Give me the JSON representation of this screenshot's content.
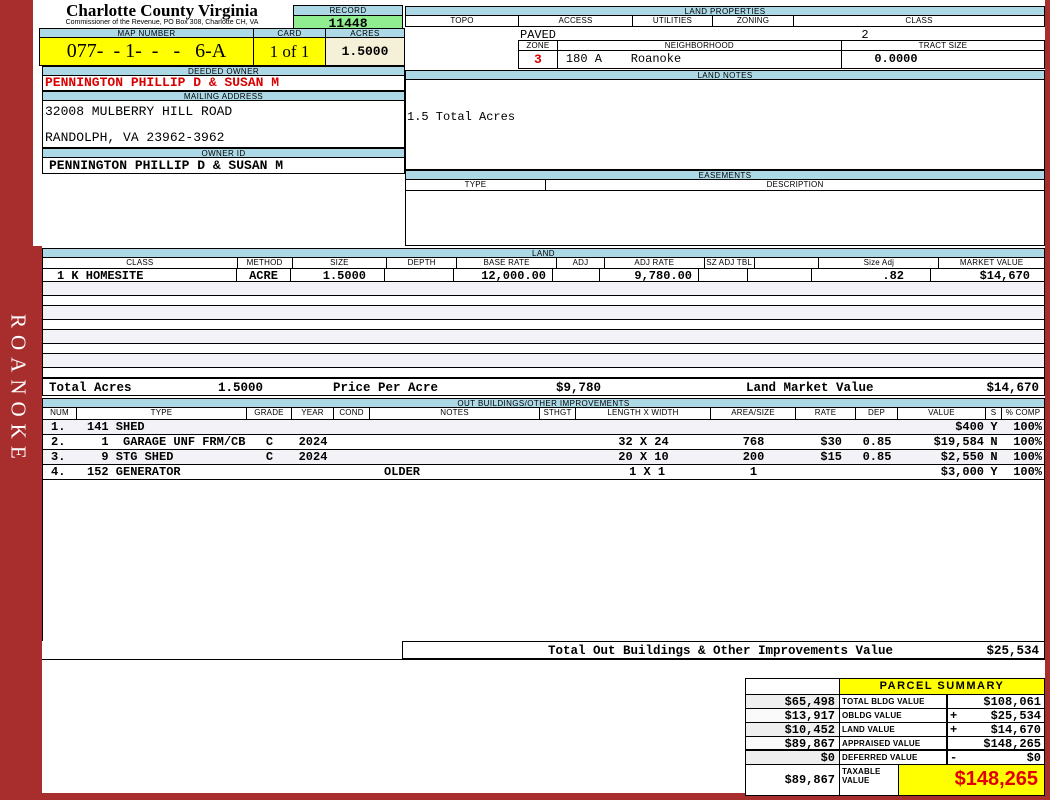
{
  "colors": {
    "frame_red": "#A82E2E",
    "header_blue": "#ADD8E6",
    "record_green": "#90EE90",
    "highlight_yellow": "#FFFF00",
    "acres_beige": "#F5F0D8",
    "accent_red": "#D90000",
    "stripe_gray": "#F2F2F7"
  },
  "sidebar": {
    "label": "ROANOKE"
  },
  "header_left": {
    "title": "Charlotte County Virginia",
    "subtitle": "Commissioner of the Revenue, PO Box 308, Charlotte CH, VA",
    "record_label": "RECORD",
    "record_value": "11448",
    "map_label": "MAP NUMBER",
    "map_value": "077-  - 1-  -   -   6-A",
    "card_label": "CARD",
    "card_value": "1 of 1",
    "acres_label": "ACRES",
    "acres_value": "1.5000",
    "deeded_owner_label": "DEEDED OWNER",
    "deeded_owner_value": "PENNINGTON PHILLIP D & SUSAN M",
    "mailing_label": "MAILING ADDRESS",
    "mailing_line1": "32008 MULBERRY HILL ROAD",
    "mailing_line2": "RANDOLPH, VA 23962-3962",
    "owner_id_label": "OWNER ID",
    "owner_id_value": "PENNINGTON PHILLIP D & SUSAN M"
  },
  "land_properties": {
    "title": "LAND PROPERTIES",
    "headers": [
      "TOPO",
      "ACCESS",
      "UTILITIES",
      "ZONING",
      "CLASS"
    ],
    "access_value": "PAVED",
    "class_value": "2",
    "zone_label": "ZONE",
    "zone_value": "3",
    "neighborhood_label": "NEIGHBORHOOD",
    "neighborhood_value": "180 A    Roanoke",
    "tract_label": "TRACT SIZE",
    "tract_value": "0.0000"
  },
  "land_notes": {
    "title": "LAND NOTES",
    "note": "1.5 Total Acres"
  },
  "easements": {
    "title": "EASEMENTS",
    "type_label": "TYPE",
    "desc_label": "DESCRIPTION"
  },
  "land_table": {
    "title": "LAND",
    "headers": [
      "CLASS",
      "METHOD",
      "SIZE",
      "DEPTH",
      "BASE RATE",
      "ADJ",
      "ADJ RATE",
      "SZ ADJ TBL",
      "",
      "Size Adj",
      "MARKET VALUE"
    ],
    "row": {
      "class": "1 K HOMESITE",
      "method": "ACRE",
      "size": "1.5000",
      "depth": "",
      "base_rate": "12,000.00",
      "adj": "",
      "adj_rate": "9,780.00",
      "sz_adj_tbl": "",
      "blank": "",
      "size_adj": ".82",
      "market_value": "$14,670"
    },
    "totals": {
      "acres_label": "Total Acres",
      "acres_value": "1.5000",
      "ppa_label": "Price Per Acre",
      "ppa_value": "$9,780",
      "lmv_label": "Land Market Value",
      "lmv_value": "$14,670"
    }
  },
  "out_buildings": {
    "title": "OUT BUILDINGS/OTHER IMPROVEMENTS",
    "headers": [
      "NUM",
      "TYPE",
      "GRADE",
      "YEAR",
      "COND",
      "NOTES",
      "STHGT",
      "LENGTH X WIDTH",
      "AREA/SIZE",
      "RATE",
      "DEP",
      "VALUE",
      "S",
      "% COMP"
    ],
    "rows": [
      {
        "num": "1.",
        "type": "141 SHED",
        "grade": "",
        "year": "",
        "cond": "",
        "notes": "",
        "sthgt": "",
        "lw": "",
        "area": "",
        "rate": "",
        "dep": "",
        "value": "$400",
        "s": "Y",
        "comp": "100%"
      },
      {
        "num": "2.",
        "type": "  1  GARAGE UNF FRM/CB",
        "grade": "C",
        "year": "2024",
        "cond": "",
        "notes": "",
        "sthgt": "",
        "lw": "32 X 24",
        "area": "768",
        "rate": "$30",
        "dep": "0.85",
        "value": "$19,584",
        "s": "N",
        "comp": "100%"
      },
      {
        "num": "3.",
        "type": "  9 STG SHED",
        "grade": "C",
        "year": "2024",
        "cond": "",
        "notes": "",
        "sthgt": "",
        "lw": "20 X 10",
        "area": "200",
        "rate": "$15",
        "dep": "0.85",
        "value": "$2,550",
        "s": "N",
        "comp": "100%"
      },
      {
        "num": "4.",
        "type": "152 GENERATOR",
        "grade": "",
        "year": "",
        "cond": "",
        "notes": "OLDER",
        "sthgt": "",
        "lw": " 1 X 1",
        "area": "1",
        "rate": "",
        "dep": "",
        "value": "$3,000",
        "s": "Y",
        "comp": "100%"
      }
    ],
    "total_label": "Total Out Buildings & Other Improvements Value",
    "total_value": "$25,534"
  },
  "parcel_summary": {
    "title": "PARCEL SUMMARY",
    "rows": [
      {
        "left": "$65,498",
        "label": "TOTAL BLDG VALUE",
        "sign": "",
        "right": "$108,061"
      },
      {
        "left": "$13,917",
        "label": "OBLDG VALUE",
        "sign": "+",
        "right": "$25,534"
      },
      {
        "left": "$10,452",
        "label": "LAND VALUE",
        "sign": "+",
        "right": "$14,670"
      },
      {
        "left": "$89,867",
        "label": "APPRAISED VALUE",
        "sign": "",
        "right": "$148,265"
      },
      {
        "left": "$0",
        "label": "DEFERRED VALUE",
        "sign": "-",
        "right": "$0"
      }
    ],
    "taxable": {
      "left": "$89,867",
      "label": "TAXABLE VALUE",
      "value": "$148,265"
    }
  }
}
